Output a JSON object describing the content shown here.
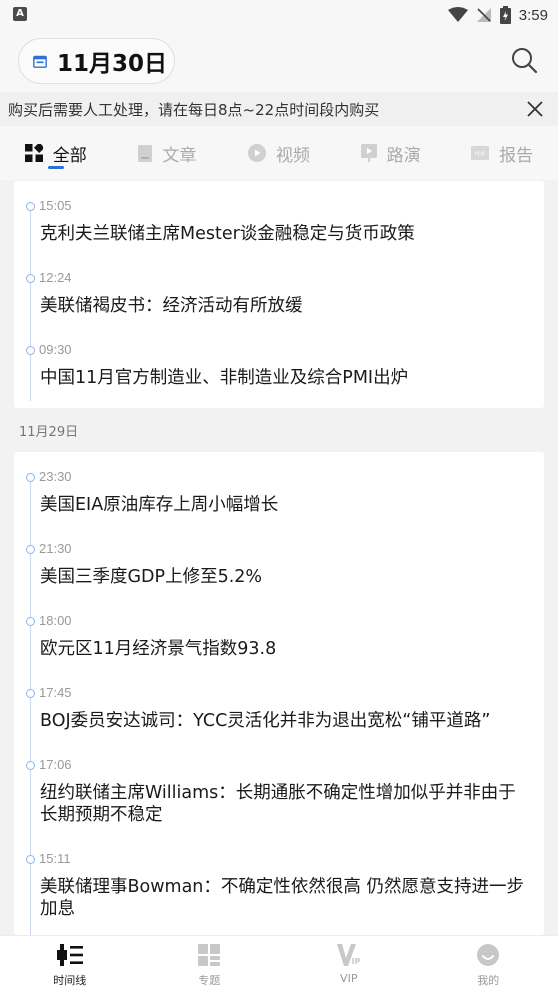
{
  "status_bar": {
    "app_badge": "A",
    "time": "3:59"
  },
  "header": {
    "date": "11月30日"
  },
  "notice": {
    "text": "购买后需要人工处理，请在每日8点~22点时间段内购买"
  },
  "tabs": [
    {
      "label": "全部",
      "icon": "grid-icon",
      "active": true
    },
    {
      "label": "文章",
      "icon": "document-icon",
      "active": false
    },
    {
      "label": "视频",
      "icon": "play-icon",
      "active": false
    },
    {
      "label": "路演",
      "icon": "roadshow-icon",
      "active": false
    },
    {
      "label": "报告",
      "icon": "pdf-icon",
      "active": false
    }
  ],
  "groups": [
    {
      "date_label": "",
      "items": [
        {
          "time": "15:05",
          "title": "克利夫兰联储主席Mester谈金融稳定与货币政策"
        },
        {
          "time": "12:24",
          "title": "美联储褐皮书：经济活动有所放缓"
        },
        {
          "time": "09:30",
          "title": "中国11月官方制造业、非制造业及综合PMI出炉"
        }
      ]
    },
    {
      "date_label": "11月29日",
      "items": [
        {
          "time": "23:30",
          "title": "美国EIA原油库存上周小幅增长"
        },
        {
          "time": "21:30",
          "title": "美国三季度GDP上修至5.2%"
        },
        {
          "time": "18:00",
          "title": "欧元区11月经济景气指数93.8"
        },
        {
          "time": "17:45",
          "title": "BOJ委员安达诚司：YCC灵活化并非为退出宽松“铺平道路”"
        },
        {
          "time": "17:06",
          "title": "纽约联储主席Williams：长期通胀不确定性增加似乎并非由于长期预期不稳定"
        },
        {
          "time": "15:11",
          "title": "美联储理事Bowman：不确定性依然很高 仍然愿意支持进一步加息"
        }
      ]
    }
  ],
  "bottom_nav": [
    {
      "label": "时间线",
      "icon": "timeline-icon",
      "active": true
    },
    {
      "label": "专题",
      "icon": "topics-icon",
      "active": false
    },
    {
      "label": "VIP",
      "icon": "vip-icon",
      "active": false
    },
    {
      "label": "我的",
      "icon": "profile-icon",
      "active": false
    }
  ],
  "colors": {
    "accent": "#2b6fd9",
    "timeline_dot": "#8fb3ea",
    "background": "#f2f2f2"
  }
}
